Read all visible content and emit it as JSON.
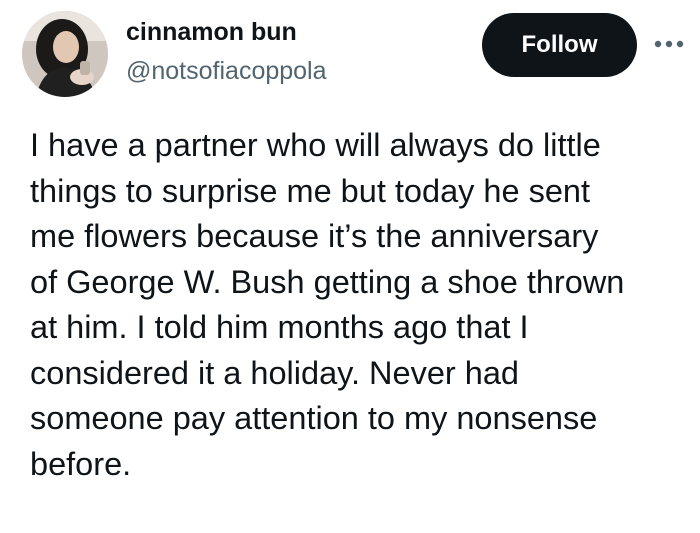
{
  "user": {
    "display_name": "cinnamon bun",
    "handle": "@notsofiacoppola"
  },
  "actions": {
    "follow_label": "Follow",
    "more_icon": "more-horizontal-icon"
  },
  "tweet": {
    "lines": [
      "I have a partner who will always do little",
      "things to surprise me but today he sent",
      "me flowers because it’s the anniversary",
      "of George W. Bush getting a shoe thrown",
      "at him. I told him months ago that I",
      "considered it a holiday. Never had",
      "someone pay attention to my nonsense",
      "before."
    ]
  },
  "colors": {
    "text": "#0f1419",
    "secondary_text": "#536471",
    "follow_bg": "#0f1419",
    "follow_text": "#ffffff",
    "background": "#ffffff"
  }
}
